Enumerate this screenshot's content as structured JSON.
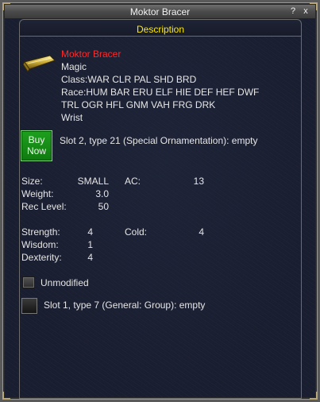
{
  "window": {
    "title": "Moktor Bracer",
    "help_label": "?",
    "close_label": "x"
  },
  "tab": {
    "label": "Description"
  },
  "item": {
    "icon": "bracer-icon",
    "name": "Moktor Bracer",
    "lines": [
      "Magic",
      "Class:WAR CLR PAL SHD BRD",
      "Race:HUM BAR ERU ELF HIE DEF HEF DWF",
      "TRL OGR HFL GNM VAH FRG DRK",
      "Wrist"
    ]
  },
  "buy_now": {
    "line1": "Buy",
    "line2": "Now",
    "color": "#19931a"
  },
  "aug_slot_top": "Slot 2, type 21 (Special Ornamentation): empty",
  "stats": {
    "size_label": "Size:",
    "size_value": "SMALL",
    "ac_label": "AC:",
    "ac_value": "13",
    "weight_label": "Weight:",
    "weight_value": "3.0",
    "rec_level_label": "Rec Level:",
    "rec_level_value": "50",
    "strength_label": "Strength:",
    "strength_value": "4",
    "cold_label": "Cold:",
    "cold_value": "4",
    "wisdom_label": "Wisdom:",
    "wisdom_value": "1",
    "dexterity_label": "Dexterity:",
    "dexterity_value": "4"
  },
  "unmodified_label": "Unmodified",
  "aug_slot_bottom": "Slot 1, type 7 (General: Group): empty",
  "colors": {
    "item_name": "#ff2a2a",
    "tab_label": "#ffea00",
    "text": "#e6e6e6"
  }
}
